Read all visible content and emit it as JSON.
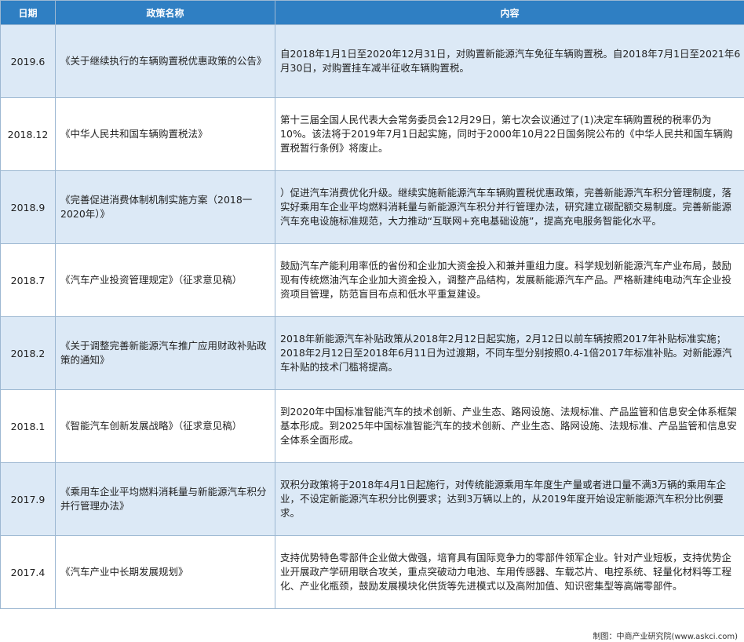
{
  "header": {
    "date": "日期",
    "policy": "政策名称",
    "content": "内容"
  },
  "rows": [
    {
      "date": "2019.6",
      "policy": "《关于继续执行的车辆购置税优惠政策的公告》",
      "content": "自2018年1月1日至2020年12月31日，对购置新能源汽车免征车辆购置税。自2018年7月1日至2021年6月30日，对购置挂车减半征收车辆购置税。"
    },
    {
      "date": "2018.12",
      "policy": "《中华人民共和国车辆购置税法》",
      "content": "第十三届全国人民代表大会常务委员会12月29日，第七次会议通过了(1)决定车辆购置税的税率仍为10%。该法将于2019年7月1日起实施，同时于2000年10月22日国务院公布的《中华人民共和国车辆购置税暂行条例》将废止。"
    },
    {
      "date": "2018.9",
      "policy": "《完善促进消费体制机制实施方案（2018一2020年）》",
      "content": "）促进汽车消费优化升级。继续实施新能源汽车车辆购置税优惠政策，完善新能源汽车积分管理制度，落实好乘用车企业平均燃料消耗量与新能源汽车积分并行管理办法，研究建立碳配额交易制度。完善新能源汽车充电设施标准规范，大力推动“互联网+充电基础设施”，提高充电服务智能化水平。"
    },
    {
      "date": "2018.7",
      "policy": "《汽车产业投资管理规定》（征求意见稿）",
      "content": "鼓励汽车产能利用率低的省份和企业加大资金投入和兼并重组力度。科学规划新能源汽车产业布局，鼓励现有传统燃油汽车企业加大资金投入，调整产品结构，发展新能源汽车产品。严格新建纯电动汽车企业投资项目管理，防范盲目布点和低水平重复建设。"
    },
    {
      "date": "2018.2",
      "policy": "《关于调整完善新能源汽车推广应用财政补贴政策的通知》",
      "content": "2018年新能源汽车补贴政策从2018年2月12日起实施，2月12日以前车辆按照2017年补贴标准实施；2018年2月12日至2018年6月11日为过渡期，不同车型分别按照0.4-1倍2017年标准补贴。对新能源汽车补贴的技术门槛将提高。"
    },
    {
      "date": "2018.1",
      "policy": "《智能汽车创新发展战略》（征求意见稿）",
      "content": "到2020年中国标准智能汽车的技术创新、产业生态、路网设施、法规标准、产品监管和信息安全体系框架基本形成。到2025年中国标准智能汽车的技术创新、产业生态、路网设施、法规标准、产品监管和信息安全体系全面形成。"
    },
    {
      "date": "2017.9",
      "policy": "《乘用车企业平均燃料消耗量与新能源汽车积分并行管理办法》",
      "content": "双积分政策将于2018年4月1日起施行，对传统能源乘用车年度生产量或者进口量不满3万辆的乘用车企业，不设定新能源汽车积分比例要求；达到3万辆以上的，从2019年度开始设定新能源汽车积分比例要求。"
    },
    {
      "date": "2017.4",
      "policy": "《汽车产业中长期发展规划》",
      "content": "支持优势特色零部件企业做大做强，培育具有国际竞争力的零部件领军企业。针对产业短板，支持优势企业开展政产学研用联合攻关，重点突破动力电池、车用传感器、车载芯片、电控系统、轻量化材料等工程化、产业化瓶颈，鼓励发展模块化供货等先进模式以及高附加值、知识密集型等高端零部件。"
    }
  ],
  "footer": {
    "credit": "制图：中商产业研究院(www.askci.com)"
  }
}
